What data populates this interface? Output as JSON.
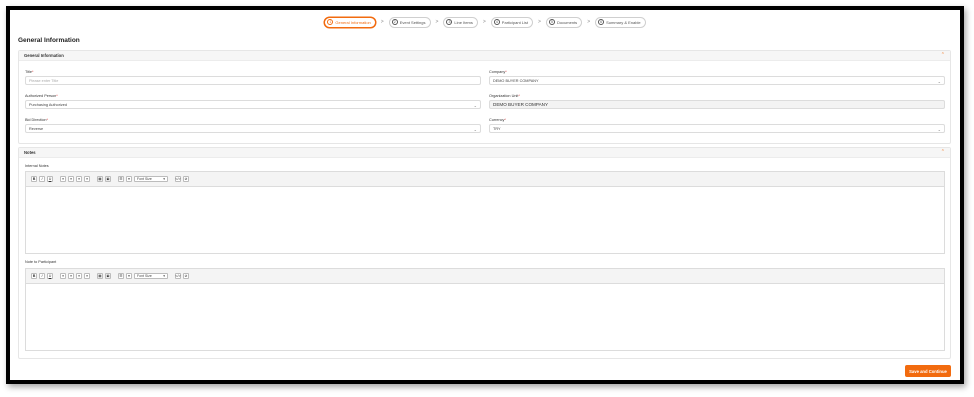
{
  "stepper": {
    "steps": [
      {
        "num": "1",
        "label": "General Information"
      },
      {
        "num": "2",
        "label": "Event Settings"
      },
      {
        "num": "3",
        "label": "Line Items"
      },
      {
        "num": "4",
        "label": "Participant List"
      },
      {
        "num": "5",
        "label": "Documents"
      },
      {
        "num": "6",
        "label": "Summary & Enable"
      }
    ],
    "separator": ">"
  },
  "page_title": "General Information",
  "general_card": {
    "title": "General Information",
    "fields": {
      "title": {
        "label": "Title",
        "placeholder": "Please enter Title"
      },
      "company": {
        "label": "Company",
        "value": "DEMO BUYER COMPANY"
      },
      "authorized_person": {
        "label": "Authorized Person",
        "value": "Purchasing Authorized"
      },
      "organization_unit": {
        "label": "Organization Unit",
        "value": "DEMO BUYER COMPANY"
      },
      "bid_direction": {
        "label": "Bid Direction",
        "value": "Reverse"
      },
      "currency": {
        "label": "Currency",
        "value": "TRY"
      }
    },
    "required_mark": "*"
  },
  "notes_card": {
    "title": "Notes",
    "internal_notes_label": "Internal Notes",
    "note_to_participant_label": "Note to Participant"
  },
  "toolbar": {
    "bold": "B",
    "italic": "I",
    "underline": "U",
    "font_size": "Font Size",
    "code": "</>",
    "link": "⊘"
  },
  "save_button": "Save and Continue",
  "colors": {
    "accent": "#f26b0f"
  }
}
